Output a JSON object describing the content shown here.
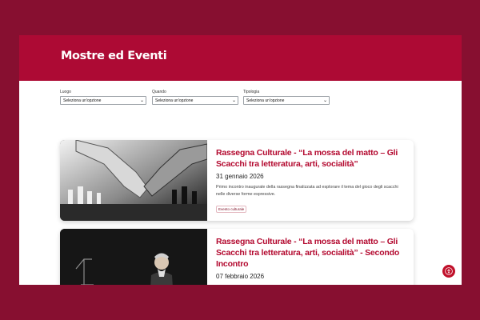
{
  "header": {
    "title": "Mostre ed Eventi"
  },
  "filters": [
    {
      "label": "Luogo",
      "placeholder": "Seleziona un'opzione"
    },
    {
      "label": "Quando",
      "placeholder": "Seleziona un'opzione"
    },
    {
      "label": "Tipologia",
      "placeholder": "Seleziona un'opzione"
    }
  ],
  "events": [
    {
      "title": "Rassegna Culturale - “La mossa del matto – Gli Scacchi tra letteratura, arti, socialità”",
      "date": "31 gennaio 2026",
      "description": "Primo incontro inaugurale della rassegna finalizzata ad esplorare il tema del gioco degli scacchi nelle diverse forme espressive.",
      "tag": "Evento culturale",
      "image": "robot-hand-chess"
    },
    {
      "title": "Rassegna Culturale - “La mossa del matto – Gli Scacchi tra letteratura, arti, socialità” - Secondo Incontro",
      "date": "07 febbraio 2026",
      "image": "man-playing-chess"
    }
  ],
  "accessibility": {
    "icon": "accessibility-icon",
    "color": "#c0102a"
  },
  "colors": {
    "brand": "#ad0a34",
    "background": "#870f30",
    "title": "#b3092f"
  }
}
